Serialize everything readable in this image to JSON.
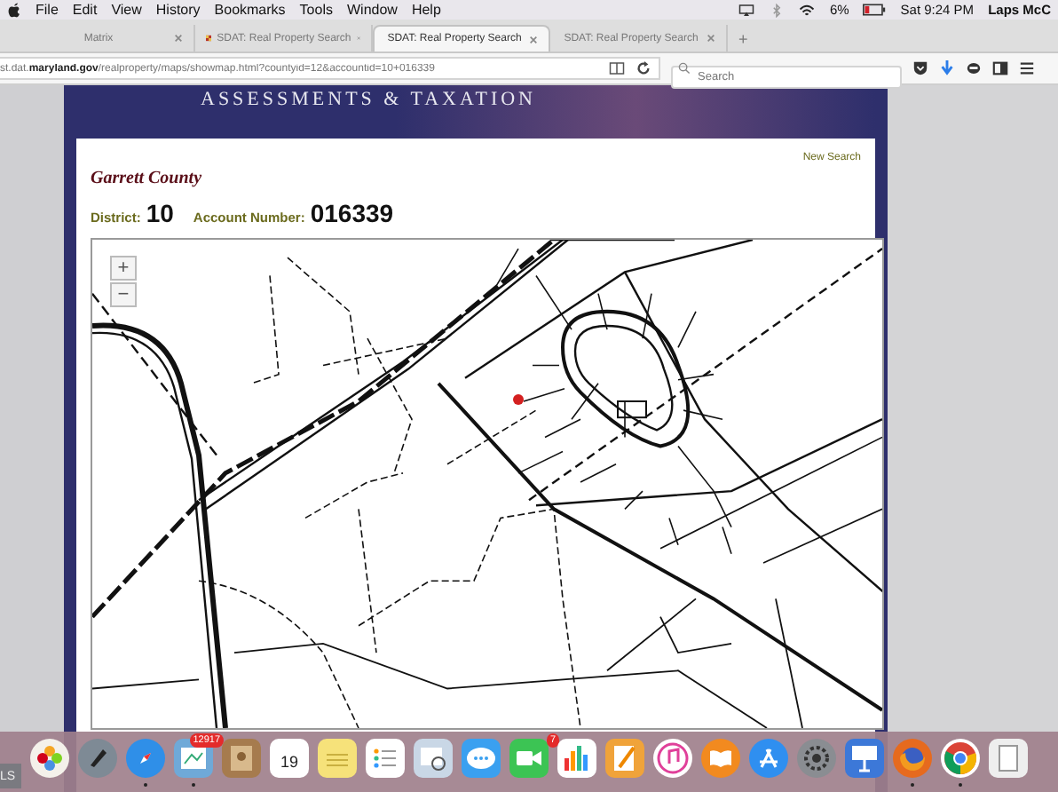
{
  "menu_bar": {
    "items": [
      "File",
      "Edit",
      "View",
      "History",
      "Bookmarks",
      "Tools",
      "Window",
      "Help"
    ],
    "battery": "6%",
    "clock": "Sat 9:24 PM",
    "user": "Laps McC"
  },
  "tabs": [
    {
      "label": "Matrix",
      "selected": false,
      "icon": false
    },
    {
      "label": "SDAT: Real Property Search",
      "selected": false,
      "icon": true
    },
    {
      "label": "SDAT: Real Property Search",
      "selected": true,
      "icon": false
    },
    {
      "label": "SDAT: Real Property Search",
      "selected": false,
      "icon": false
    }
  ],
  "new_tab": "+",
  "address_bar": {
    "prefix": "st.dat.",
    "domain": "maryland.gov",
    "path": "/realproperty/maps/showmap.html?countyid=12&accountid=10+016339"
  },
  "search": {
    "placeholder": "Search"
  },
  "banner": {
    "title": "ASSESSMENTS & TAXATION"
  },
  "page": {
    "new_search": "New Search",
    "county": "Garrett County",
    "district_label": "District:",
    "district": "10",
    "account_label": "Account Number:",
    "account": "016339"
  },
  "map": {
    "zoom_in": "+",
    "zoom_out": "−"
  },
  "corner_label": "LS",
  "dock": [
    {
      "kind": "photos",
      "running": false
    },
    {
      "kind": "launchpad",
      "running": false
    },
    {
      "kind": "safari",
      "running": true
    },
    {
      "kind": "mail",
      "badge": "12917",
      "running": true
    },
    {
      "kind": "contacts",
      "running": false
    },
    {
      "kind": "calendar",
      "label": "19",
      "running": false
    },
    {
      "kind": "notes",
      "running": false
    },
    {
      "kind": "reminders",
      "running": false
    },
    {
      "kind": "preview",
      "running": false
    },
    {
      "kind": "messages",
      "running": false
    },
    {
      "kind": "facetime",
      "badge": "7",
      "running": false
    },
    {
      "kind": "numbers",
      "running": false
    },
    {
      "kind": "pages",
      "running": false
    },
    {
      "kind": "music",
      "running": false
    },
    {
      "kind": "books",
      "running": false
    },
    {
      "kind": "appstore",
      "running": false
    },
    {
      "kind": "settings",
      "running": false
    },
    {
      "kind": "keynote",
      "running": false
    },
    {
      "kind": "firefox",
      "running": true
    },
    {
      "kind": "chrome",
      "running": true
    },
    {
      "kind": "document",
      "running": false
    }
  ]
}
